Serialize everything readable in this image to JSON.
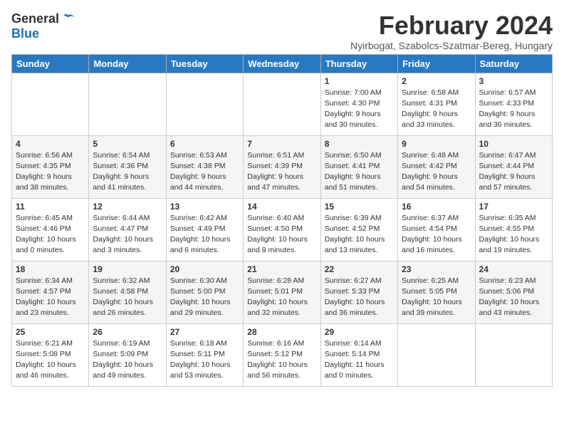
{
  "header": {
    "logo_general": "General",
    "logo_blue": "Blue",
    "month_title": "February 2024",
    "location": "Nyirbogat, Szabolcs-Szatmar-Bereg, Hungary"
  },
  "days_of_week": [
    "Sunday",
    "Monday",
    "Tuesday",
    "Wednesday",
    "Thursday",
    "Friday",
    "Saturday"
  ],
  "weeks": [
    [
      {
        "day": "",
        "info": ""
      },
      {
        "day": "",
        "info": ""
      },
      {
        "day": "",
        "info": ""
      },
      {
        "day": "",
        "info": ""
      },
      {
        "day": "1",
        "info": "Sunrise: 7:00 AM\nSunset: 4:30 PM\nDaylight: 9 hours\nand 30 minutes."
      },
      {
        "day": "2",
        "info": "Sunrise: 6:58 AM\nSunset: 4:31 PM\nDaylight: 9 hours\nand 33 minutes."
      },
      {
        "day": "3",
        "info": "Sunrise: 6:57 AM\nSunset: 4:33 PM\nDaylight: 9 hours\nand 36 minutes."
      }
    ],
    [
      {
        "day": "4",
        "info": "Sunrise: 6:56 AM\nSunset: 4:35 PM\nDaylight: 9 hours\nand 38 minutes."
      },
      {
        "day": "5",
        "info": "Sunrise: 6:54 AM\nSunset: 4:36 PM\nDaylight: 9 hours\nand 41 minutes."
      },
      {
        "day": "6",
        "info": "Sunrise: 6:53 AM\nSunset: 4:38 PM\nDaylight: 9 hours\nand 44 minutes."
      },
      {
        "day": "7",
        "info": "Sunrise: 6:51 AM\nSunset: 4:39 PM\nDaylight: 9 hours\nand 47 minutes."
      },
      {
        "day": "8",
        "info": "Sunrise: 6:50 AM\nSunset: 4:41 PM\nDaylight: 9 hours\nand 51 minutes."
      },
      {
        "day": "9",
        "info": "Sunrise: 6:48 AM\nSunset: 4:42 PM\nDaylight: 9 hours\nand 54 minutes."
      },
      {
        "day": "10",
        "info": "Sunrise: 6:47 AM\nSunset: 4:44 PM\nDaylight: 9 hours\nand 57 minutes."
      }
    ],
    [
      {
        "day": "11",
        "info": "Sunrise: 6:45 AM\nSunset: 4:46 PM\nDaylight: 10 hours\nand 0 minutes."
      },
      {
        "day": "12",
        "info": "Sunrise: 6:44 AM\nSunset: 4:47 PM\nDaylight: 10 hours\nand 3 minutes."
      },
      {
        "day": "13",
        "info": "Sunrise: 6:42 AM\nSunset: 4:49 PM\nDaylight: 10 hours\nand 6 minutes."
      },
      {
        "day": "14",
        "info": "Sunrise: 6:40 AM\nSunset: 4:50 PM\nDaylight: 10 hours\nand 9 minutes."
      },
      {
        "day": "15",
        "info": "Sunrise: 6:39 AM\nSunset: 4:52 PM\nDaylight: 10 hours\nand 13 minutes."
      },
      {
        "day": "16",
        "info": "Sunrise: 6:37 AM\nSunset: 4:54 PM\nDaylight: 10 hours\nand 16 minutes."
      },
      {
        "day": "17",
        "info": "Sunrise: 6:35 AM\nSunset: 4:55 PM\nDaylight: 10 hours\nand 19 minutes."
      }
    ],
    [
      {
        "day": "18",
        "info": "Sunrise: 6:34 AM\nSunset: 4:57 PM\nDaylight: 10 hours\nand 23 minutes."
      },
      {
        "day": "19",
        "info": "Sunrise: 6:32 AM\nSunset: 4:58 PM\nDaylight: 10 hours\nand 26 minutes."
      },
      {
        "day": "20",
        "info": "Sunrise: 6:30 AM\nSunset: 5:00 PM\nDaylight: 10 hours\nand 29 minutes."
      },
      {
        "day": "21",
        "info": "Sunrise: 6:28 AM\nSunset: 5:01 PM\nDaylight: 10 hours\nand 32 minutes."
      },
      {
        "day": "22",
        "info": "Sunrise: 6:27 AM\nSunset: 5:33 PM\nDaylight: 10 hours\nand 36 minutes."
      },
      {
        "day": "23",
        "info": "Sunrise: 6:25 AM\nSunset: 5:05 PM\nDaylight: 10 hours\nand 39 minutes."
      },
      {
        "day": "24",
        "info": "Sunrise: 6:23 AM\nSunset: 5:06 PM\nDaylight: 10 hours\nand 43 minutes."
      }
    ],
    [
      {
        "day": "25",
        "info": "Sunrise: 6:21 AM\nSunset: 5:08 PM\nDaylight: 10 hours\nand 46 minutes."
      },
      {
        "day": "26",
        "info": "Sunrise: 6:19 AM\nSunset: 5:09 PM\nDaylight: 10 hours\nand 49 minutes."
      },
      {
        "day": "27",
        "info": "Sunrise: 6:18 AM\nSunset: 5:11 PM\nDaylight: 10 hours\nand 53 minutes."
      },
      {
        "day": "28",
        "info": "Sunrise: 6:16 AM\nSunset: 5:12 PM\nDaylight: 10 hours\nand 56 minutes."
      },
      {
        "day": "29",
        "info": "Sunrise: 6:14 AM\nSunset: 5:14 PM\nDaylight: 11 hours\nand 0 minutes."
      },
      {
        "day": "",
        "info": ""
      },
      {
        "day": "",
        "info": ""
      }
    ]
  ]
}
